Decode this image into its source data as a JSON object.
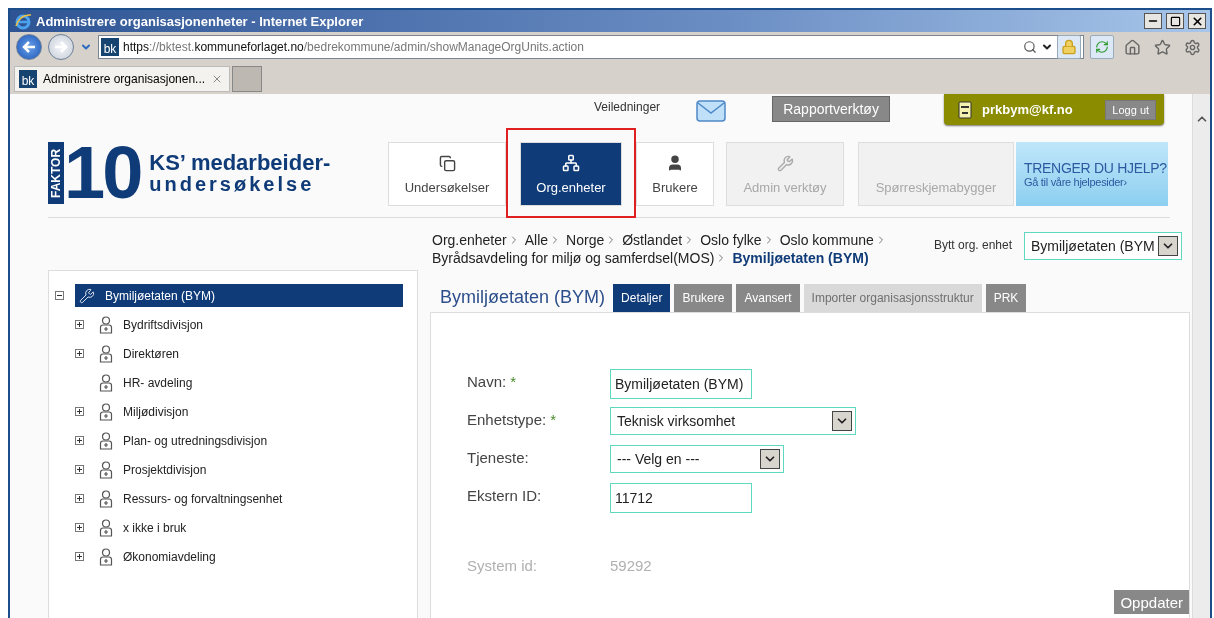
{
  "window": {
    "title": "Administrere organisasjonenheter - Internet Explorer"
  },
  "address_bar": {
    "site_logo": "bk",
    "url_parts": [
      {
        "text": "https",
        "emphasis": true
      },
      {
        "text": "://bktest.",
        "emphasis": false
      },
      {
        "text": "kommuneforlaget.no",
        "emphasis": true
      },
      {
        "text": "/bedrekommune/admin/showManageOrgUnits.action",
        "emphasis": false
      }
    ]
  },
  "browser_tabs": [
    {
      "site_logo": "bk",
      "label": "Administrere organisasjonen...",
      "selected": true
    }
  ],
  "top_bar": {
    "guides_label": "Veiledninger",
    "report_button": "Rapportverktøy",
    "user": "prkbym@kf.no",
    "logout_button": "Logg ut"
  },
  "logo": {
    "number": "10",
    "tag": "FAKTOR",
    "line_1": "KS’ medarbeider-",
    "line_2": "undersøkelse"
  },
  "nav": [
    {
      "label": "Undersøkelser",
      "selected": false,
      "disabled": false,
      "highlighted": false
    },
    {
      "label": "Org.enheter",
      "selected": true,
      "disabled": false,
      "highlighted": true
    },
    {
      "label": "Brukere",
      "selected": false,
      "disabled": false,
      "highlighted": false
    },
    {
      "label": "Admin verktøy",
      "selected": false,
      "disabled": true,
      "highlighted": false
    },
    {
      "label": "Spørreskjemabygger",
      "selected": false,
      "disabled": true,
      "highlighted": false
    }
  ],
  "help_banner": {
    "title": "TRENGER DU HJELP?",
    "link": "Gå til våre hjelpesider›"
  },
  "tree": [
    {
      "label": "Bymiljøetaten (BYM)",
      "kind": "root",
      "expanded": true,
      "selected": true,
      "children": [
        {
          "label": "Bydriftsdivisjon",
          "kind": "branch",
          "expanded": false,
          "selected": false
        },
        {
          "label": "Direktøren",
          "kind": "branch",
          "expanded": false,
          "selected": false
        },
        {
          "label": "HR- avdeling",
          "kind": "leaf",
          "selected": false
        },
        {
          "label": "Miljødivisjon",
          "kind": "branch",
          "expanded": false,
          "selected": false
        },
        {
          "label": "Plan- og utredningsdivisjon",
          "kind": "branch",
          "expanded": false,
          "selected": false
        },
        {
          "label": "Prosjektdivisjon",
          "kind": "branch",
          "expanded": false,
          "selected": false
        },
        {
          "label": "Ressurs- og forvaltningsenhet",
          "kind": "branch",
          "expanded": false,
          "selected": false
        },
        {
          "label": "x ikke i bruk",
          "kind": "branch",
          "expanded": false,
          "selected": false
        },
        {
          "label": "Økonomiavdeling",
          "kind": "branch",
          "expanded": false,
          "selected": false
        }
      ]
    }
  ],
  "breadcrumb": [
    {
      "label": "Org.enheter",
      "current": false
    },
    {
      "label": "Alle",
      "current": false
    },
    {
      "label": "Norge",
      "current": false
    },
    {
      "label": "Østlandet",
      "current": false
    },
    {
      "label": "Oslo fylke",
      "current": false
    },
    {
      "label": "Oslo kommune",
      "current": false
    },
    {
      "label": "Byrådsavdeling for miljø og samferdsel(MOS)",
      "current": false
    },
    {
      "label": "Bymiljøetaten (BYM)",
      "current": true
    }
  ],
  "switch_unit": {
    "label": "Bytt org. enhet",
    "value": "Bymiljøetaten (BYM"
  },
  "detail": {
    "title": "Bymiljøetaten (BYM)",
    "tabs": [
      {
        "label": "Detaljer",
        "selected": true,
        "disabled": false
      },
      {
        "label": "Brukere",
        "selected": false,
        "disabled": false
      },
      {
        "label": "Avansert",
        "selected": false,
        "disabled": false
      },
      {
        "label": "Importer organisasjonsstruktur",
        "selected": false,
        "disabled": true
      },
      {
        "label": "PRK",
        "selected": false,
        "disabled": false
      }
    ],
    "fields": [
      {
        "label": "Navn:",
        "required": true,
        "kind": "text",
        "value": "Bymiljøetaten (BYM)"
      },
      {
        "label": "Enhetstype:",
        "required": true,
        "kind": "select",
        "value": "Teknisk virksomhet"
      },
      {
        "label": "Tjeneste:",
        "required": false,
        "kind": "select",
        "value": "--- Velg en ---"
      },
      {
        "label": "Ekstern ID:",
        "required": false,
        "kind": "text",
        "value": "11712"
      },
      {
        "label": "System id:",
        "required": false,
        "kind": "readonly",
        "value": "59292"
      }
    ],
    "required_mark": "*",
    "submit_button": "Oppdater"
  }
}
